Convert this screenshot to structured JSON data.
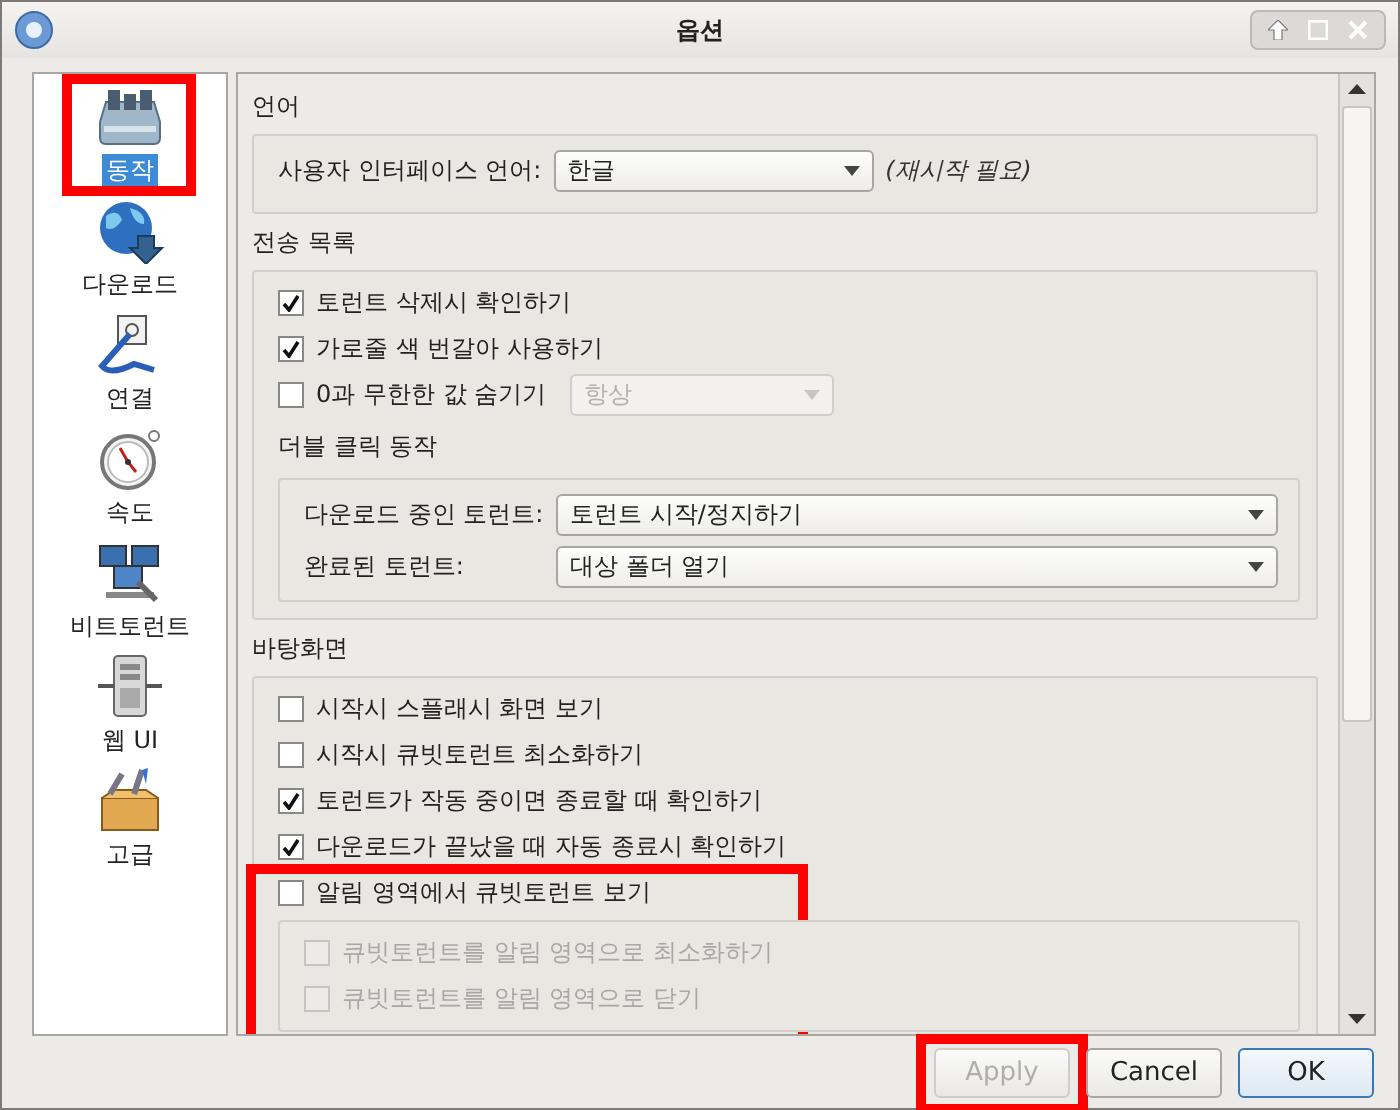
{
  "window": {
    "title": "옵션"
  },
  "sidebar": {
    "items": [
      {
        "label": "동작",
        "selected": true,
        "highlighted": true
      },
      {
        "label": "다운로드",
        "selected": false,
        "highlighted": false
      },
      {
        "label": "연결",
        "selected": false,
        "highlighted": false
      },
      {
        "label": "속도",
        "selected": false,
        "highlighted": false
      },
      {
        "label": "비트토런트",
        "selected": false,
        "highlighted": false
      },
      {
        "label": "웹 UI",
        "selected": false,
        "highlighted": false
      },
      {
        "label": "고급",
        "selected": false,
        "highlighted": false
      }
    ]
  },
  "sections": [
    {
      "title": "언어",
      "rows": [
        {
          "kind": "combo",
          "label": "사용자 인터페이스 언어:",
          "value": "한글",
          "disabled": false,
          "note": "(재시작 필요)"
        }
      ]
    },
    {
      "title": "전송 목록",
      "rows": [
        {
          "kind": "checkbox",
          "label": "토런트 삭제시 확인하기",
          "checked": true,
          "disabled": false
        },
        {
          "kind": "checkbox",
          "label": "가로줄 색 번갈아 사용하기",
          "checked": true,
          "disabled": false
        },
        {
          "kind": "checkbox",
          "label": "0과 무한한 값 숨기기",
          "checked": false,
          "disabled": false,
          "combo": {
            "value": "항상",
            "disabled": true
          }
        },
        {
          "kind": "heading",
          "label": "더블 클릭 동작"
        },
        {
          "kind": "group",
          "highlighted": false,
          "rows": [
            {
              "kind": "combo",
              "label": "다운로드 중인 토런트:",
              "value": "토런트 시작/정지하기",
              "disabled": false
            },
            {
              "kind": "combo",
              "label": "완료된 토런트:",
              "value": "대상 폴더 열기",
              "disabled": false
            }
          ]
        }
      ]
    },
    {
      "title": "바탕화면",
      "rows": [
        {
          "kind": "checkbox",
          "label": "시작시 스플래시 화면 보기",
          "checked": false,
          "disabled": false
        },
        {
          "kind": "checkbox",
          "label": "시작시 큐빗토런트 최소화하기",
          "checked": false,
          "disabled": false
        },
        {
          "kind": "checkbox",
          "label": "토런트가 작동 중이면 종료할 때 확인하기",
          "checked": true,
          "disabled": false
        },
        {
          "kind": "checkbox",
          "label": "다운로드가 끝났을 때 자동 종료시 확인하기",
          "checked": true,
          "disabled": false
        },
        {
          "kind": "checkbox",
          "label": "알림 영역에서 큐빗토런트 보기",
          "checked": false,
          "disabled": false,
          "highlighted": true
        },
        {
          "kind": "group",
          "highlighted": false,
          "rows": [
            {
              "kind": "checkbox",
              "label": "큐빗토런트를 알림 영역으로 최소화하기",
              "checked": false,
              "disabled": true
            },
            {
              "kind": "checkbox",
              "label": "큐빗토런트를 알림 영역으로 닫기",
              "checked": false,
              "disabled": true
            }
          ]
        }
      ]
    }
  ],
  "buttons": [
    {
      "label": "Apply",
      "disabled": true,
      "default": false,
      "highlighted": true
    },
    {
      "label": "Cancel",
      "disabled": false,
      "default": false,
      "highlighted": false
    },
    {
      "label": "OK",
      "disabled": false,
      "default": true,
      "highlighted": false
    }
  ]
}
